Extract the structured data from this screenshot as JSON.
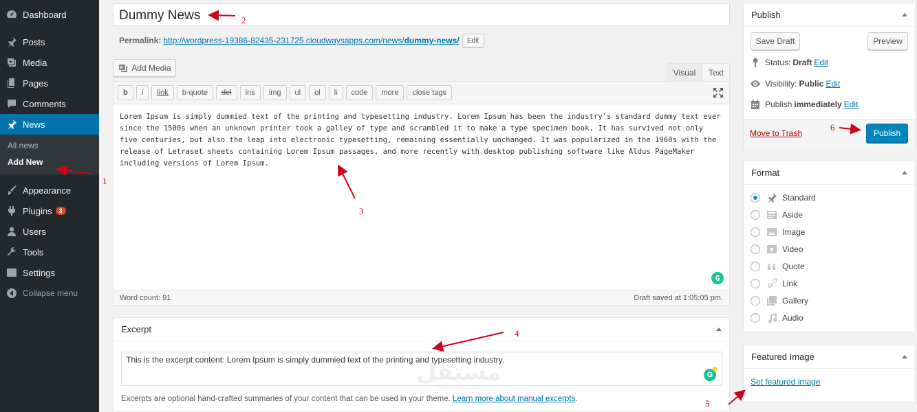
{
  "sidebar": {
    "items": [
      {
        "label": "Dashboard",
        "icon": "dashboard-icon"
      },
      {
        "label": "Posts",
        "icon": "pin-icon"
      },
      {
        "label": "Media",
        "icon": "media-icon"
      },
      {
        "label": "Pages",
        "icon": "pages-icon"
      },
      {
        "label": "Comments",
        "icon": "comment-icon"
      },
      {
        "label": "News",
        "icon": "pin-icon"
      },
      {
        "label": "Appearance",
        "icon": "brush-icon"
      },
      {
        "label": "Plugins",
        "icon": "plugin-icon",
        "badge": "3"
      },
      {
        "label": "Users",
        "icon": "user-icon"
      },
      {
        "label": "Tools",
        "icon": "wrench-icon"
      },
      {
        "label": "Settings",
        "icon": "settings-icon"
      }
    ],
    "submenu": [
      "All news",
      "Add New"
    ],
    "collapse_label": "Collapse menu"
  },
  "post": {
    "title": "Dummy News",
    "permalink_label": "Permalink:",
    "permalink_base": "http://wordpress-19386-82435-231725.cloudwaysapps.com/news/",
    "permalink_slug": "dummy-news/",
    "permalink_edit": "Edit"
  },
  "editor": {
    "add_media": "Add Media",
    "tab_visual": "Visual",
    "tab_text": "Text",
    "quicktags": [
      "b",
      "i",
      "link",
      "b-quote",
      "del",
      "ins",
      "img",
      "ul",
      "ol",
      "li",
      "code",
      "more",
      "close tags"
    ],
    "content": "Lorem Ipsum is simply dummied text of the printing and typesetting industry. Lorem Ipsum has been the industry's standard dummy text ever since the 1500s when an unknown printer took a galley of type and scrambled it to make a type specimen book. It has survived not only five centuries, but also the leap into electronic typesetting, remaining essentially unchanged. It was popularized in the 1960s with the release of Letraset sheets containing Lorem Ipsum passages, and more recently with desktop publishing software like Aldus PageMaker including versions of Lorem Ipsum.",
    "word_count": "Word count: 91",
    "draft_saved": "Draft saved at 1:05:05 pm."
  },
  "excerpt": {
    "title": "Excerpt",
    "value": "This is the excerpt content: Lorem Ipsum is simply dummied text of the printing and typesetting industry.",
    "help_text": "Excerpts are optional hand-crafted summaries of your content that can be used in your theme.",
    "help_link": "Learn more about manual excerpts",
    "help_end": "."
  },
  "publish": {
    "title": "Publish",
    "save_draft": "Save Draft",
    "preview": "Preview",
    "status_label": "Status:",
    "status_value": "Draft",
    "visibility_label": "Visibility:",
    "visibility_value": "Public",
    "publish_label": "Publish",
    "publish_value": "immediately",
    "edit": "Edit",
    "trash": "Move to Trash",
    "publish_button": "Publish"
  },
  "format": {
    "title": "Format",
    "options": [
      {
        "label": "Standard",
        "icon": "pin-icon",
        "checked": true
      },
      {
        "label": "Aside",
        "icon": "aside-icon",
        "checked": false
      },
      {
        "label": "Image",
        "icon": "image-icon",
        "checked": false
      },
      {
        "label": "Video",
        "icon": "video-icon",
        "checked": false
      },
      {
        "label": "Quote",
        "icon": "quote-icon",
        "checked": false
      },
      {
        "label": "Link",
        "icon": "link-icon",
        "checked": false
      },
      {
        "label": "Gallery",
        "icon": "gallery-icon",
        "checked": false
      },
      {
        "label": "Audio",
        "icon": "audio-icon",
        "checked": false
      }
    ]
  },
  "featured_image": {
    "title": "Featured Image",
    "link": "Set featured image"
  },
  "annotations": [
    "1",
    "2",
    "3",
    "4",
    "5",
    "6"
  ],
  "watermark": {
    "main": "مستقل",
    "sub": "mostaql.com"
  },
  "colors": {
    "sidebar": "#23282d",
    "active": "#0073aa",
    "publish": "#0085ba",
    "annotation": "#d0021b"
  }
}
